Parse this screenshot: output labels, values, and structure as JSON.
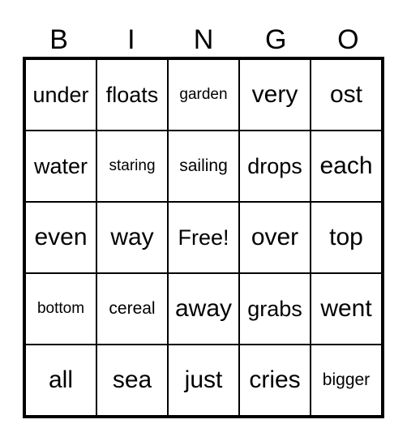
{
  "header": [
    "B",
    "I",
    "N",
    "G",
    "O"
  ],
  "rows": [
    [
      "under",
      "floats",
      "garden",
      "very",
      "ost"
    ],
    [
      "water",
      "staring",
      "sailing",
      "drops",
      "each"
    ],
    [
      "even",
      "way",
      "Free!",
      "over",
      "top"
    ],
    [
      "bottom",
      "cereal",
      "away",
      "grabs",
      "went"
    ],
    [
      "all",
      "sea",
      "just",
      "cries",
      "bigger"
    ]
  ]
}
